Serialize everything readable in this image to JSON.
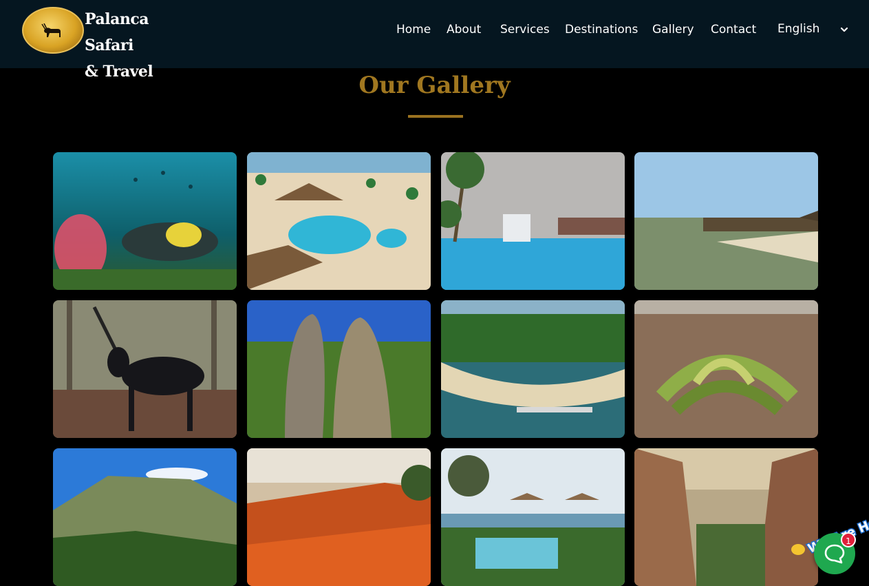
{
  "brand": {
    "name_line1": "Palanca Safari",
    "name_line2": "& Travel",
    "logo_icon": "antelope-logo-icon",
    "logo_color": "#d9a324"
  },
  "nav": {
    "items": [
      {
        "label": "Home"
      },
      {
        "label": "About"
      },
      {
        "label": "Services"
      },
      {
        "label": "Destinations"
      },
      {
        "label": "Gallery"
      },
      {
        "label": "Contact"
      }
    ],
    "language": {
      "selected": "English",
      "icon": "chevron-down-icon"
    }
  },
  "gallery": {
    "title": "Our Gallery",
    "accent_color": "#a07720",
    "images": [
      {
        "subject": "scuba-diver-coral"
      },
      {
        "subject": "resort-pool-aerial"
      },
      {
        "subject": "pool-palm-trees"
      },
      {
        "subject": "beach-umbrellas"
      },
      {
        "subject": "sable-antelope"
      },
      {
        "subject": "rock-formations"
      },
      {
        "subject": "coastal-resort-aerial"
      },
      {
        "subject": "welwitschia-plant"
      },
      {
        "subject": "mountain-cliff"
      },
      {
        "subject": "red-canyon"
      },
      {
        "subject": "beach-pool-parasols"
      },
      {
        "subject": "cliff-viewpoint"
      }
    ]
  },
  "chat": {
    "tag_text": "We Are Here!",
    "badge_count": "1",
    "icon": "chat-bubble-icon",
    "color": "#1fa84f"
  }
}
